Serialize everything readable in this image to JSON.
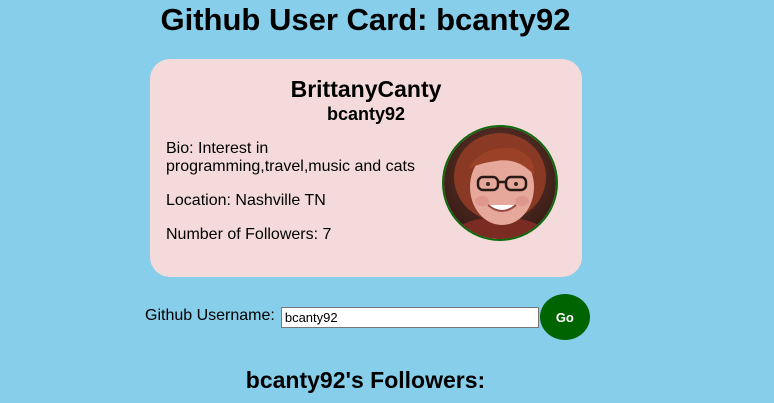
{
  "header": {
    "title": "Github User Card: bcanty92"
  },
  "card": {
    "name": "BrittanyCanty",
    "login": "bcanty92",
    "bio": "Bio: Interest in programming,travel,music and cats",
    "location": "Location: Nashville TN",
    "followers": "Number of Followers: 7",
    "avatar_icon": "user-avatar-photo"
  },
  "search": {
    "label": "Github Username:",
    "value": "bcanty92",
    "button_label": "Go"
  },
  "followers_section": {
    "heading": "bcanty92's Followers:"
  },
  "colors": {
    "background": "#87ceea",
    "card": "#f4dada",
    "button": "#006400",
    "avatar_border": "#0b6b0b"
  }
}
